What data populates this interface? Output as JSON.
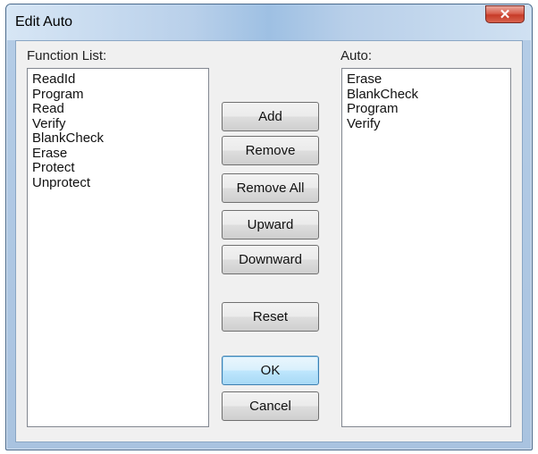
{
  "window": {
    "title": "Edit Auto",
    "close_glyph": "✕"
  },
  "function_list": {
    "label": "Function List:",
    "items": [
      "ReadId",
      "Program",
      "Read",
      "Verify",
      "BlankCheck",
      "Erase",
      "Protect",
      "Unprotect"
    ]
  },
  "auto_list": {
    "label": "Auto:",
    "items": [
      "Erase",
      "BlankCheck",
      "Program",
      "Verify"
    ]
  },
  "buttons": {
    "add": "Add",
    "remove": "Remove",
    "remove_all": "Remove All",
    "upward": "Upward",
    "downward": "Downward",
    "reset": "Reset",
    "ok": "OK",
    "cancel": "Cancel"
  },
  "colors": {
    "title_bar": "#b9d0ea",
    "close_button": "#c63b28",
    "dialog_body": "#f0f0f0",
    "default_button_border": "#3c7fb1"
  }
}
